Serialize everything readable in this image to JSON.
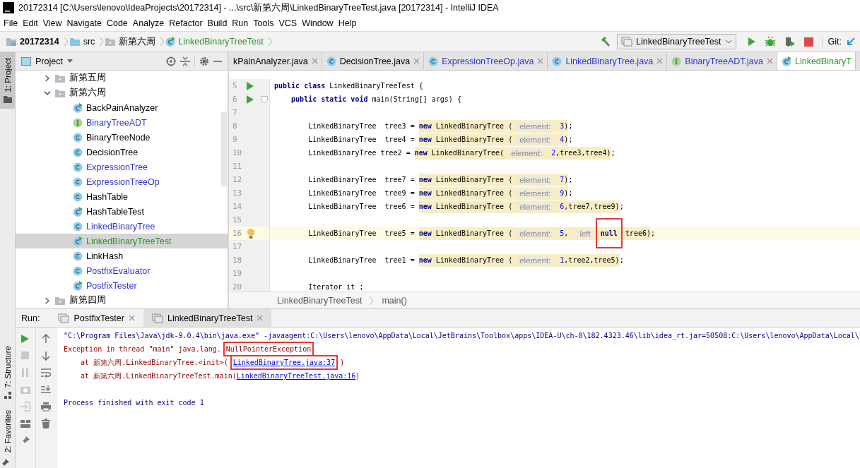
{
  "window": {
    "title": "20172314 [C:\\Users\\lenovo\\IdeaProjects\\20172314] - ...\\src\\新第六周\\LinkedBinaryTreeTest.java [20172314] - IntelliJ IDEA"
  },
  "menu": [
    "File",
    "Edit",
    "View",
    "Navigate",
    "Code",
    "Analyze",
    "Refactor",
    "Build",
    "Run",
    "Tools",
    "VCS",
    "Window",
    "Help"
  ],
  "breadcrumbs": [
    {
      "label": "20172314",
      "kind": "module"
    },
    {
      "label": "src",
      "kind": "folder"
    },
    {
      "label": "新第六周",
      "kind": "package"
    },
    {
      "label": "LinkedBinaryTreeTest",
      "kind": "runnable"
    }
  ],
  "toolbar": {
    "run_config": "LinkedBinaryTreeTest",
    "git_label": "Git:"
  },
  "side_tabs": [
    {
      "label": "1: Project",
      "selected": true
    },
    {
      "label": "7: Structure",
      "selected": false
    },
    {
      "label": "2: Favorites",
      "selected": false
    }
  ],
  "project": {
    "title": "Project",
    "items": [
      {
        "label": "新第五周",
        "kind": "folder",
        "expanded": false,
        "selected": false
      },
      {
        "label": "新第六周",
        "kind": "folder",
        "expanded": true,
        "selected": false,
        "children": [
          {
            "label": "BackPainAnalyzer",
            "kind": "runnable",
            "color": "#000000",
            "selected": false
          },
          {
            "label": "BinaryTreeADT",
            "kind": "interface",
            "color": "#3333cc",
            "selected": false
          },
          {
            "label": "BinaryTreeNode",
            "kind": "class",
            "color": "#000000",
            "selected": false
          },
          {
            "label": "DecisionTree",
            "kind": "class",
            "color": "#000000",
            "selected": false
          },
          {
            "label": "ExpressionTree",
            "kind": "class",
            "color": "#3333cc",
            "selected": false
          },
          {
            "label": "ExpressionTreeOp",
            "kind": "class",
            "color": "#3333cc",
            "selected": false
          },
          {
            "label": "HashTable",
            "kind": "class",
            "color": "#000000",
            "selected": false
          },
          {
            "label": "HashTableTest",
            "kind": "runnable",
            "color": "#000000",
            "selected": false
          },
          {
            "label": "LinkedBinaryTree",
            "kind": "class",
            "color": "#3333cc",
            "selected": false
          },
          {
            "label": "LinkedBinaryTreeTest",
            "kind": "runnable",
            "color": "#2f8f2f",
            "selected": true
          },
          {
            "label": "LinkHash",
            "kind": "class",
            "color": "#000000",
            "selected": false
          },
          {
            "label": "PostfixEvaluator",
            "kind": "class",
            "color": "#3333cc",
            "selected": false
          },
          {
            "label": "PostfixTester",
            "kind": "runnable",
            "color": "#3333cc",
            "selected": false
          }
        ]
      },
      {
        "label": "新第四周",
        "kind": "folder",
        "expanded": false,
        "selected": false
      }
    ]
  },
  "editor": {
    "tabs": [
      {
        "label": "kPainAnalyzer.java",
        "kind": "none",
        "color": "#000000",
        "selected": false,
        "closable": true
      },
      {
        "label": "DecisionTree.java",
        "kind": "class",
        "color": "#000000",
        "selected": false,
        "closable": true
      },
      {
        "label": "ExpressionTreeOp.java",
        "kind": "class",
        "color": "#3333cc",
        "selected": false,
        "closable": true
      },
      {
        "label": "LinkedBinaryTree.java",
        "kind": "class",
        "color": "#3333cc",
        "selected": false,
        "closable": true
      },
      {
        "label": "BinaryTreeADT.java",
        "kind": "interface",
        "color": "#3333cc",
        "selected": false,
        "closable": true
      },
      {
        "label": "LinkedBinaryT",
        "kind": "runnable",
        "color": "#2f8f2f",
        "selected": true,
        "closable": false
      }
    ],
    "lines": [
      {
        "number": "5",
        "current": false,
        "gutter": [
          {
            "kind": "run"
          }
        ],
        "pre": [
          {
            "kind": "kw",
            "t": "public class"
          },
          {
            "kind": "plain",
            "t": " LinkedBinaryTreeTest {"
          }
        ]
      },
      {
        "number": "6",
        "current": false,
        "gutter": [
          {
            "kind": "run"
          },
          {
            "kind": "fold"
          }
        ],
        "pre": [
          {
            "kind": "kw",
            "t": "    public static void"
          },
          {
            "kind": "plain",
            "t": " main(String[] args) {"
          }
        ]
      },
      {
        "number": "7",
        "current": false
      },
      {
        "number": "8",
        "current": false,
        "pre": [
          {
            "kind": "plain",
            "t": "        LinkedBinaryTree  tree3 = "
          }
        ],
        "call": [
          {
            "kind": "kw",
            "t": "new"
          },
          {
            "kind": "plain",
            "t": " LinkedBinaryTree ( "
          },
          {
            "kind": "hint",
            "t": "element:"
          },
          {
            "kind": "num",
            "t": " 3"
          },
          {
            "kind": "plain",
            "t": ")"
          }
        ],
        "post": [
          {
            "kind": "plain",
            "t": ";"
          }
        ]
      },
      {
        "number": "9",
        "current": false,
        "pre": [
          {
            "kind": "plain",
            "t": "        LinkedBinaryTree  tree4 = "
          }
        ],
        "call": [
          {
            "kind": "kw",
            "t": "new"
          },
          {
            "kind": "plain",
            "t": " LinkedBinaryTree ( "
          },
          {
            "kind": "hint",
            "t": "element:"
          },
          {
            "kind": "num",
            "t": " 4"
          },
          {
            "kind": "plain",
            "t": ")"
          }
        ],
        "post": [
          {
            "kind": "plain",
            "t": ";"
          }
        ]
      },
      {
        "number": "10",
        "current": false,
        "pre": [
          {
            "kind": "plain",
            "t": "        LinkedBinaryTree tree2 = "
          }
        ],
        "call": [
          {
            "kind": "kw",
            "t": "new"
          },
          {
            "kind": "plain",
            "t": " LinkedBinaryTree( "
          },
          {
            "kind": "hint",
            "t": "element:"
          },
          {
            "kind": "num",
            "t": " 2"
          },
          {
            "kind": "plain",
            "t": ",tree3,tree4)"
          }
        ],
        "post": [
          {
            "kind": "plain",
            "t": ";"
          }
        ]
      },
      {
        "number": "11",
        "current": false
      },
      {
        "number": "12",
        "current": false,
        "pre": [
          {
            "kind": "plain",
            "t": "        LinkedBinaryTree  tree7 = "
          }
        ],
        "call": [
          {
            "kind": "kw",
            "t": "new"
          },
          {
            "kind": "plain",
            "t": " LinkedBinaryTree ( "
          },
          {
            "kind": "hint",
            "t": "element:"
          },
          {
            "kind": "num",
            "t": " 7"
          },
          {
            "kind": "plain",
            "t": ")"
          }
        ],
        "post": [
          {
            "kind": "plain",
            "t": ";"
          }
        ]
      },
      {
        "number": "13",
        "current": false,
        "pre": [
          {
            "kind": "plain",
            "t": "        LinkedBinaryTree  tree9 = "
          }
        ],
        "call": [
          {
            "kind": "kw",
            "t": "new"
          },
          {
            "kind": "plain",
            "t": " LinkedBinaryTree ( "
          },
          {
            "kind": "hint",
            "t": "element:"
          },
          {
            "kind": "num",
            "t": " 9"
          },
          {
            "kind": "plain",
            "t": ")"
          }
        ],
        "post": [
          {
            "kind": "plain",
            "t": ";"
          }
        ]
      },
      {
        "number": "14",
        "current": false,
        "pre": [
          {
            "kind": "plain",
            "t": "        LinkedBinaryTree  tree6 = "
          }
        ],
        "call": [
          {
            "kind": "kw",
            "t": "new"
          },
          {
            "kind": "plain",
            "t": " LinkedBinaryTree ( "
          },
          {
            "kind": "hint",
            "t": "element:"
          },
          {
            "kind": "num",
            "t": " 6"
          },
          {
            "kind": "plain",
            "t": ",tree7,tree9)"
          }
        ],
        "post": [
          {
            "kind": "plain",
            "t": ";"
          }
        ]
      },
      {
        "number": "15",
        "current": false
      },
      {
        "number": "16",
        "current": true,
        "gutter": [
          {
            "kind": "bulb"
          }
        ],
        "pre": [
          {
            "kind": "plain",
            "t": "        LinkedBinaryTree  tree5 = "
          }
        ],
        "call": [
          {
            "kind": "kw",
            "t": "new"
          },
          {
            "kind": "plain",
            "t": " LinkedBinaryTree ( "
          },
          {
            "kind": "hint",
            "t": "element:"
          },
          {
            "kind": "num",
            "t": " 5"
          },
          {
            "kind": "plain",
            "t": ",  "
          },
          {
            "kind": "hint",
            "t": "left"
          },
          {
            "kind": "kw",
            "t": "null",
            "boxed": true
          },
          {
            "kind": "plain",
            "t": "tree6)"
          }
        ],
        "post": [
          {
            "kind": "plain",
            "t": ";"
          }
        ]
      },
      {
        "number": "17",
        "current": false
      },
      {
        "number": "18",
        "current": false,
        "pre": [
          {
            "kind": "plain",
            "t": "        LinkedBinaryTree  tree1 = "
          }
        ],
        "call": [
          {
            "kind": "kw",
            "t": "new"
          },
          {
            "kind": "plain",
            "t": " LinkedBinaryTree ( "
          },
          {
            "kind": "hint",
            "t": "element:"
          },
          {
            "kind": "num",
            "t": " 1"
          },
          {
            "kind": "plain",
            "t": ",tree2,tree5)"
          }
        ],
        "post": [
          {
            "kind": "plain",
            "t": ";"
          }
        ]
      },
      {
        "number": "19",
        "current": false
      },
      {
        "number": "20",
        "current": false,
        "pre": [
          {
            "kind": "plain",
            "t": "        Iterator it ;"
          }
        ]
      }
    ],
    "breadcrumbs": [
      "LinkedBinaryTreeTest",
      "main()"
    ]
  },
  "run": {
    "label": "Run:",
    "tabs": [
      {
        "label": "PostfixTester",
        "selected": false
      },
      {
        "label": "LinkedBinaryTreeTest",
        "selected": true
      }
    ],
    "console": [
      [
        {
          "kind": "cmd",
          "t": "\"C:\\Program Files\\Java\\jdk-9.0.4\\bin\\java.exe\" -javaagent:C:\\Users\\lenovo\\AppData\\Local\\JetBrains\\Toolbox\\apps\\IDEA-U\\ch-0\\182.4323.46\\lib\\idea_rt.jar=50508:C:\\Users\\lenovo\\AppData\\Local\\"
        }
      ],
      [
        {
          "kind": "err",
          "t": "Exception in thread \"main\" java.lang."
        },
        {
          "kind": "err",
          "t": "NullPointerException",
          "boxed": true
        }
      ],
      [
        {
          "kind": "err",
          "t": "    at 新第六周.LinkedBinaryTree.<init>("
        },
        {
          "kind": "link",
          "t": "LinkedBinaryTree.java:37",
          "boxed": true
        },
        {
          "kind": "err",
          "t": ")"
        }
      ],
      [
        {
          "kind": "err",
          "t": "    at 新第六周.LinkedBinaryTreeTest.main("
        },
        {
          "kind": "link",
          "t": "LinkedBinaryTreeTest.java:16"
        },
        {
          "kind": "err",
          "t": ")"
        }
      ],
      [
        {
          "kind": "info",
          "t": "Process finished with exit code 1"
        }
      ]
    ]
  }
}
